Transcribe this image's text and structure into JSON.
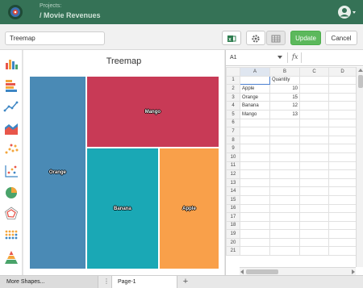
{
  "header": {
    "project_label": "Projects:",
    "project_title": "/ Movie Revenues",
    "brand_color": "#357256"
  },
  "toolbar": {
    "chart_name_value": "Treemap",
    "update_label": "Update",
    "cancel_label": "Cancel",
    "icons": [
      "export-excel-icon",
      "gear-icon",
      "table-icon"
    ]
  },
  "sidebar": {
    "items": [
      {
        "icon": "bar-chart-icon"
      },
      {
        "icon": "horizontal-bar-icon"
      },
      {
        "icon": "line-chart-icon"
      },
      {
        "icon": "area-chart-icon"
      },
      {
        "icon": "scatter-plot-icon"
      },
      {
        "icon": "scatter-axes-icon"
      },
      {
        "icon": "pie-chart-icon"
      },
      {
        "icon": "radar-chart-icon"
      },
      {
        "icon": "dot-matrix-icon"
      },
      {
        "icon": "pyramid-chart-icon"
      }
    ]
  },
  "chart_data": {
    "type": "treemap",
    "title": "Treemap",
    "categories": [
      "Orange",
      "Mango",
      "Banana",
      "Apple"
    ],
    "values": [
      15,
      13,
      12,
      10
    ],
    "colors": [
      "#4a8ab5",
      "#c83a56",
      "#1aa8b5",
      "#f9a04a"
    ]
  },
  "sheet": {
    "cell_ref": "A1",
    "fx_label": "fx",
    "columns": [
      "A",
      "B",
      "C",
      "D"
    ],
    "rows": [
      [
        "",
        "Quantity",
        "",
        ""
      ],
      [
        "Apple",
        "10",
        "",
        ""
      ],
      [
        "Orange",
        "15",
        "",
        ""
      ],
      [
        "Banana",
        "12",
        "",
        ""
      ],
      [
        "Mango",
        "13",
        "",
        ""
      ],
      [
        "",
        "",
        "",
        ""
      ],
      [
        "",
        "",
        "",
        ""
      ],
      [
        "",
        "",
        "",
        ""
      ],
      [
        "",
        "",
        "",
        ""
      ],
      [
        "",
        "",
        "",
        ""
      ],
      [
        "",
        "",
        "",
        ""
      ],
      [
        "",
        "",
        "",
        ""
      ],
      [
        "",
        "",
        "",
        ""
      ],
      [
        "",
        "",
        "",
        ""
      ],
      [
        "",
        "",
        "",
        ""
      ],
      [
        "",
        "",
        "",
        ""
      ],
      [
        "",
        "",
        "",
        ""
      ],
      [
        "",
        "",
        "",
        ""
      ],
      [
        "",
        "",
        "",
        ""
      ],
      [
        "",
        "",
        "",
        ""
      ],
      [
        "",
        "",
        "",
        ""
      ]
    ]
  },
  "bottom": {
    "more_shapes": "More Shapes...",
    "page_tab": "Page-1",
    "page_menu": "⋮",
    "add_page": "+"
  }
}
